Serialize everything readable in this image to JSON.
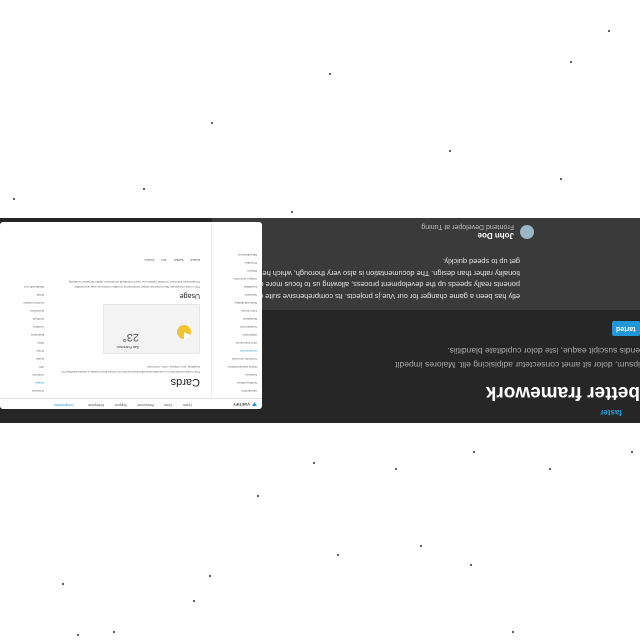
{
  "hero": {
    "kicker": "faster",
    "headline": "better framework",
    "lead": "ipsum, dolor sit amet consectetur adipisicing elit. Maiores impedit endis suscipit eaque, iste dolor cupiditate blanditiis.",
    "cta_label": "tarted"
  },
  "testimonial": {
    "quote": "etly has been a game changer for our Vue.js projects. Its comprehensive suite of ponents really speeds up the development process, allowing us to focus more on tionality rather than design. The documentation is also very thorough, which helped get up to speed quickly.",
    "author_name": "John Doe",
    "author_role": "Frontend Developer at Tuning"
  },
  "screenshot": {
    "brand": "VUETIFY",
    "nav": [
      "Learn",
      "Docs",
      "Resources",
      "Support",
      "Enterprise",
      "Components"
    ],
    "page_title": "Cards",
    "page_desc": "The v-card component is a versatile and enhanced version of v-sheet that provides a simple interface for headings, text, images, icons, and more.",
    "usage_title": "Usage",
    "usage_desc": "The v-card component has numerous helper components to make markup as easy as possible. Components that have no listed options use Vue's functional component option for faster rendering.",
    "card_label": "San Francisco",
    "card_value": "23°",
    "tabs": [
      "Default",
      "Subtitle",
      "Text",
      "Actions"
    ],
    "left_menu": [
      "Introduction",
      "Getting started",
      "Features",
      "Styles and animations",
      "Common concepts",
      "Components",
      "All Components",
      "Application",
      "Containment",
      "Navigation",
      "Form inputs",
      "Data and display",
      "Selection",
      "Feedback",
      "Images and icons",
      "Pickers",
      "Providers",
      "Miscellaneous"
    ],
    "toc": [
      "Contents",
      "Usage",
      "Anatomy",
      "API",
      "Guide",
      "Props",
      "Slots",
      "Examples",
      "Loading",
      "Outlined",
      "Horizontal",
      "Custom actions",
      "Grids",
      "Media with text"
    ]
  }
}
